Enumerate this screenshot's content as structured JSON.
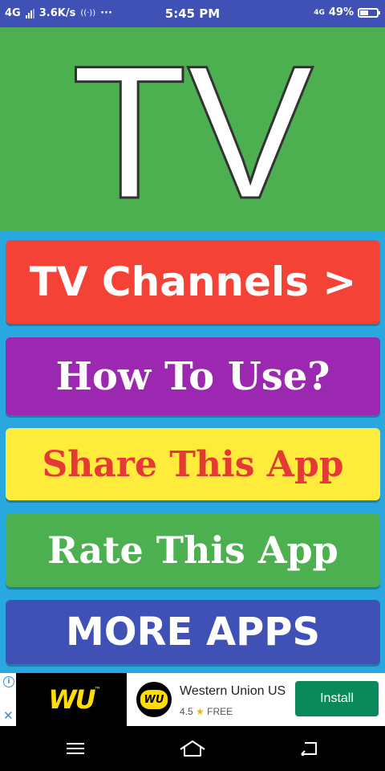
{
  "status_bar": {
    "network": "4G",
    "speed": "3.6K/s",
    "dots": "···",
    "time": "5:45 PM",
    "network_right": "4G",
    "battery_text": "49%",
    "battery_level": 0.49
  },
  "logo": {
    "text": "TV"
  },
  "menu": {
    "tv_channels": "TV Channels >",
    "how_to_use": "How To Use?",
    "share": "Share This App",
    "rate": "Rate This App",
    "more_apps": "MORE APPS"
  },
  "ad": {
    "banner_text": "WU",
    "banner_tm": "™",
    "app_icon_text": "WU",
    "app_name": "Western Union US",
    "rating": "4.5",
    "price": "FREE",
    "install_label": "Install",
    "info_glyph": "i",
    "close_glyph": "✕"
  },
  "icons": {
    "signal": "signal-bars-icon",
    "hotspot": "hotspot-icon",
    "battery": "battery-icon",
    "menu": "hamburger-icon",
    "home": "home-icon",
    "back": "back-icon"
  },
  "colors": {
    "status_bar": "#3f51b5",
    "logo_bg": "#4caf50",
    "menu_bg": "#29a8e0",
    "tv_channels": "#f44336",
    "how_to_use": "#9c27b0",
    "share": "#ffeb3b",
    "share_text": "#e53935",
    "rate": "#4caf50",
    "more_apps": "#3f51b5",
    "install": "#0a8a5a"
  }
}
